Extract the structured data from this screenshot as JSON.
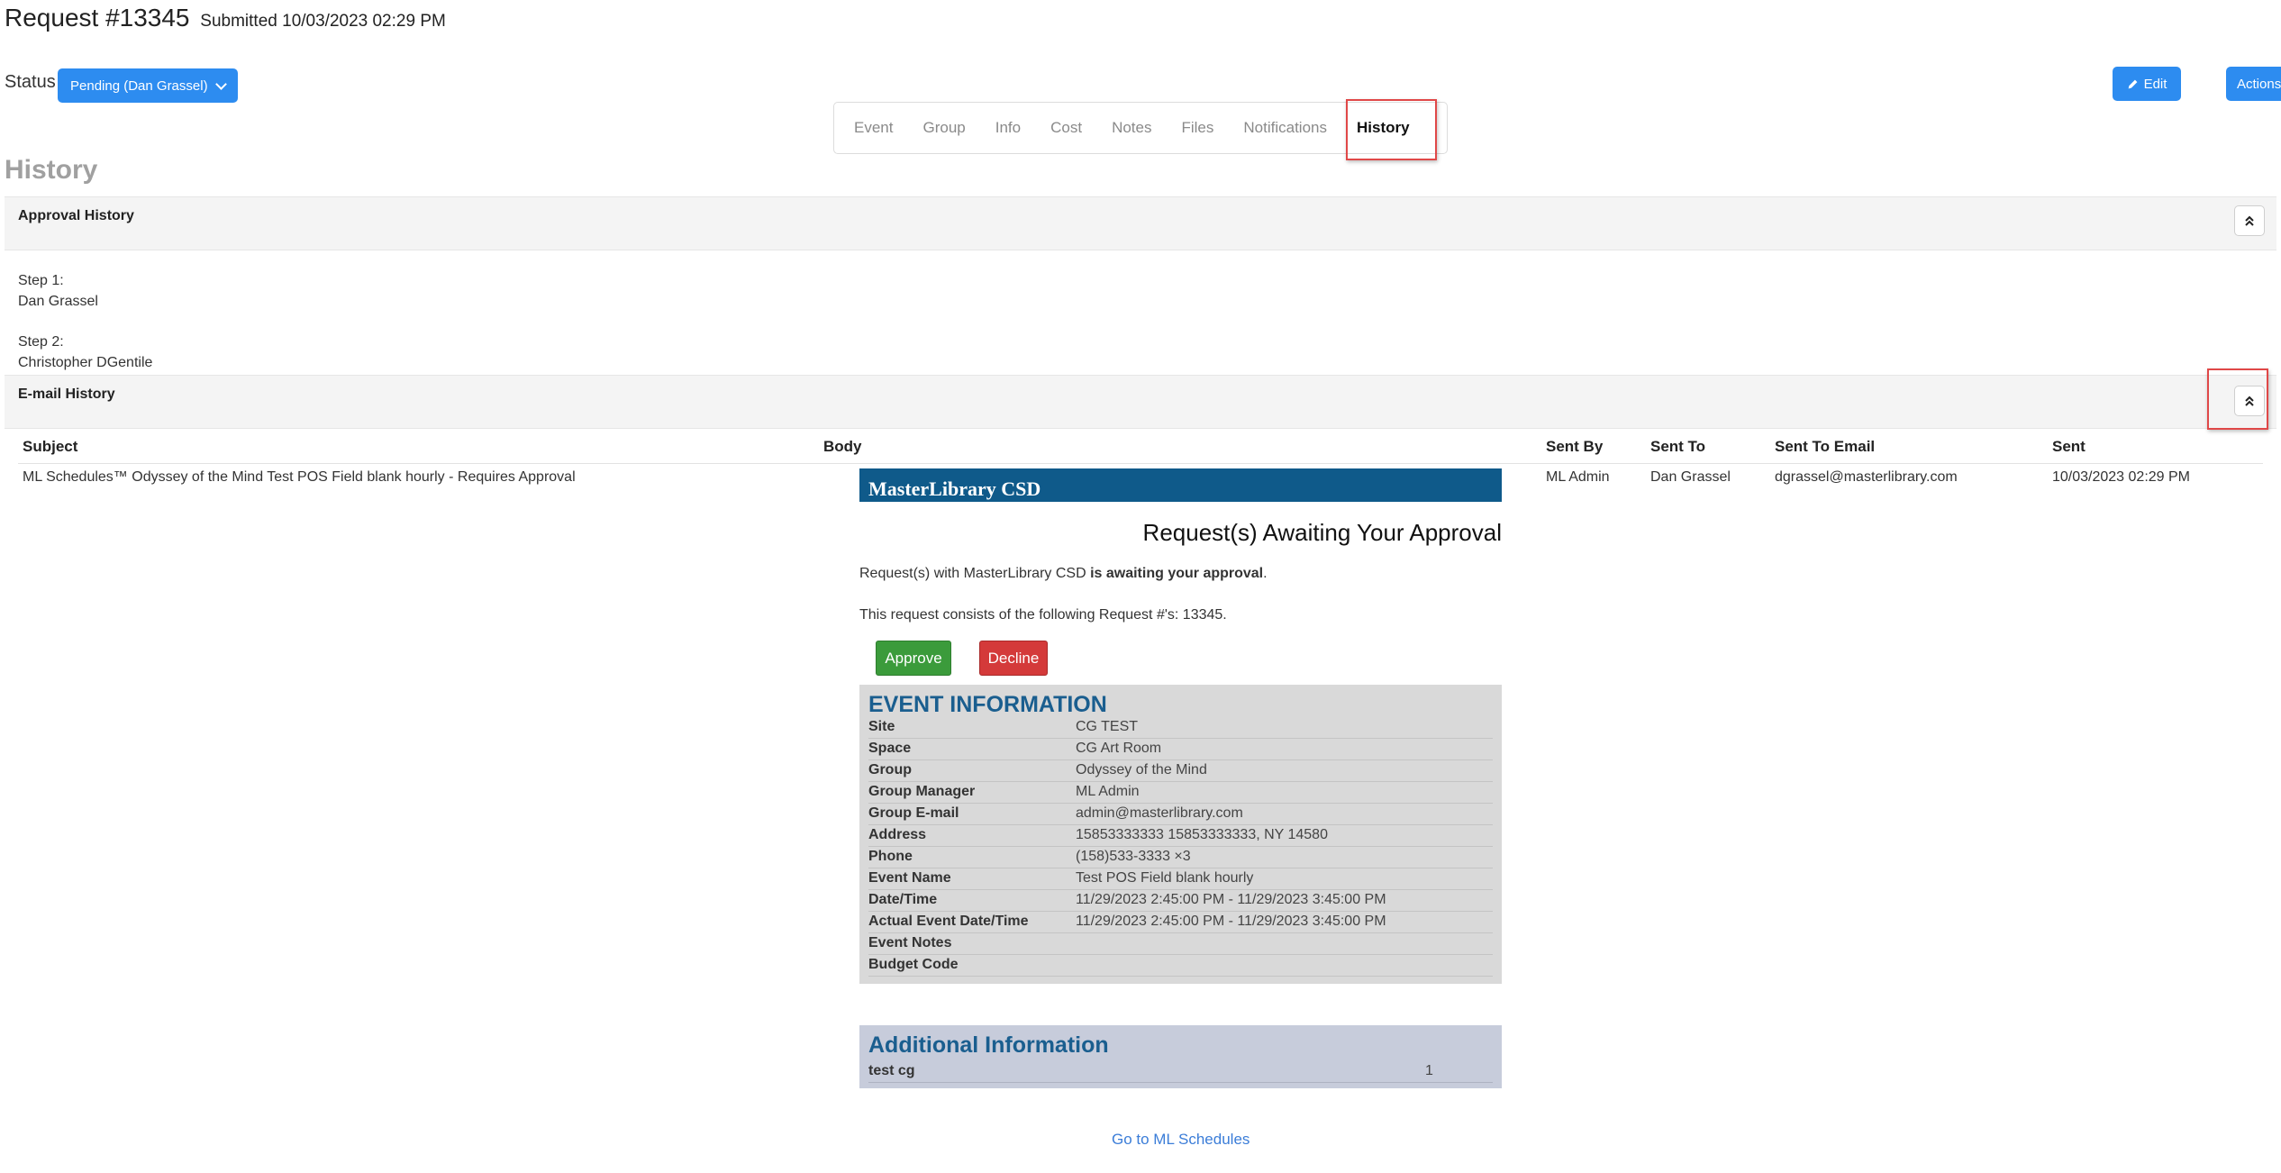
{
  "header": {
    "title": "Request #13345",
    "submitted": "Submitted 10/03/2023 02:29 PM",
    "status_label": "Status",
    "status_value": "Pending (Dan Grassel)",
    "edit_label": "Edit",
    "actions_label": "Actions"
  },
  "tabs": [
    {
      "label": "Event"
    },
    {
      "label": "Group"
    },
    {
      "label": "Info"
    },
    {
      "label": "Cost"
    },
    {
      "label": "Notes"
    },
    {
      "label": "Files"
    },
    {
      "label": "Notifications"
    },
    {
      "label": "History",
      "active": true
    }
  ],
  "section_title": "History",
  "approval_history": {
    "title": "Approval History",
    "steps": [
      {
        "step": "Step 1:",
        "name": "Dan Grassel"
      },
      {
        "step": "Step 2:",
        "name": "Christopher DGentile"
      }
    ]
  },
  "email_history": {
    "title": "E-mail History",
    "columns": [
      "Subject",
      "Body",
      "Sent By",
      "Sent To",
      "Sent To Email",
      "Sent"
    ],
    "row": {
      "subject": "ML Schedules™ Odyssey of the Mind Test POS Field blank hourly - Requires Approval",
      "sent_by": "ML Admin",
      "sent_to": "Dan Grassel",
      "sent_to_email": "dgrassel@masterlibrary.com",
      "sent": "10/03/2023 02:29 PM"
    }
  },
  "email_body": {
    "banner": "MasterLibrary CSD",
    "heading": "Request(s) Awaiting Your Approval",
    "line1_prefix": "Request(s) with MasterLibrary CSD ",
    "line1_bold": "is awaiting your approval",
    "line1_suffix": ".",
    "line2": "This request consists of the following Request #'s: 13345.",
    "approve_label": "Approve",
    "decline_label": "Decline",
    "event_info_title": "EVENT INFORMATION",
    "event_rows": [
      {
        "label": "Site",
        "value": "CG TEST"
      },
      {
        "label": "Space",
        "value": "CG Art Room"
      },
      {
        "label": "Group",
        "value": "Odyssey of the Mind"
      },
      {
        "label": "Group Manager",
        "value": "ML Admin"
      },
      {
        "label": "Group E-mail",
        "value": "admin@masterlibrary.com"
      },
      {
        "label": "Address",
        "value": "15853333333 15853333333, NY 14580"
      },
      {
        "label": "Phone",
        "value": "(158)533-3333 ×3"
      },
      {
        "label": "Event Name",
        "value": "Test POS Field blank hourly"
      },
      {
        "label": "Date/Time",
        "value": "11/29/2023 2:45:00 PM - 11/29/2023 3:45:00 PM"
      },
      {
        "label": "Actual Event Date/Time",
        "value": "11/29/2023 2:45:00 PM - 11/29/2023 3:45:00 PM"
      },
      {
        "label": "Event Notes",
        "value": ""
      },
      {
        "label": "Budget Code",
        "value": ""
      }
    ],
    "additional_title": "Additional Information",
    "additional_rows": [
      {
        "label": "test cg",
        "value": "1"
      }
    ],
    "link": "Go to ML Schedules"
  },
  "colors": {
    "primary": "#2d8cf0",
    "highlight": "#e04848",
    "banner": "#0f5a8a",
    "approve": "#3b9b3b",
    "decline": "#d43a3a"
  }
}
